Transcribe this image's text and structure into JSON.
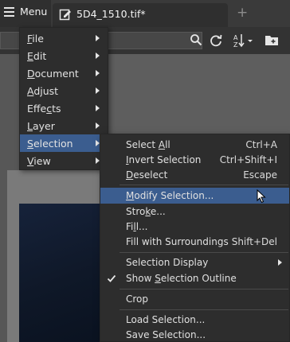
{
  "topbar": {
    "menu_label": "Menu",
    "tab_title": "5D4_1510.tif*",
    "new_tab_label": "+"
  },
  "toolbar": {
    "icons": [
      "search-icon",
      "refresh-icon",
      "sort-icon",
      "new-folder-icon"
    ]
  },
  "main_menu": {
    "items": [
      {
        "pre": "",
        "key": "F",
        "post": "ile"
      },
      {
        "pre": "",
        "key": "E",
        "post": "dit"
      },
      {
        "pre": "",
        "key": "D",
        "post": "ocument"
      },
      {
        "pre": "",
        "key": "A",
        "post": "djust"
      },
      {
        "pre": "Effe",
        "key": "c",
        "post": "ts"
      },
      {
        "pre": "",
        "key": "L",
        "post": "ayer"
      },
      {
        "pre": "",
        "key": "S",
        "post": "election"
      },
      {
        "pre": "",
        "key": "V",
        "post": "iew"
      }
    ],
    "active_index": 6
  },
  "sub_menu": {
    "items": [
      {
        "pre": "Select ",
        "key": "A",
        "post": "ll",
        "shortcut": "Ctrl+A"
      },
      {
        "pre": "",
        "key": "I",
        "post": "nvert Selection",
        "shortcut": "Ctrl+Shift+I"
      },
      {
        "pre": "",
        "key": "D",
        "post": "eselect",
        "shortcut": "Escape"
      },
      {
        "pre": "",
        "key": "M",
        "post": "odify Selection...",
        "shortcut": ""
      },
      {
        "pre": "Stro",
        "key": "k",
        "post": "e...",
        "shortcut": ""
      },
      {
        "pre": "Fi",
        "key": "l",
        "post": "l...",
        "shortcut": ""
      },
      {
        "pre": "Fill with Surroundings",
        "key": "",
        "post": "",
        "shortcut": "Shift+Del"
      },
      {
        "pre": "Selection Display",
        "key": "",
        "post": "",
        "shortcut": ""
      },
      {
        "pre": "Show ",
        "key": "S",
        "post": "election Outline",
        "shortcut": ""
      },
      {
        "pre": "Crop",
        "key": "",
        "post": "",
        "shortcut": ""
      },
      {
        "pre": "Load Selection...",
        "key": "",
        "post": "",
        "shortcut": ""
      },
      {
        "pre": "Save Selection...",
        "key": "",
        "post": "",
        "shortcut": ""
      }
    ],
    "hover_index": 3,
    "checked_index": 8
  },
  "colors": {
    "menu_bg": "#2d2d2d",
    "highlight": "#3b5d8f",
    "text": "#e0e0e0",
    "topbar": "#3a3a3a",
    "canvas": "#5e5e5e"
  }
}
